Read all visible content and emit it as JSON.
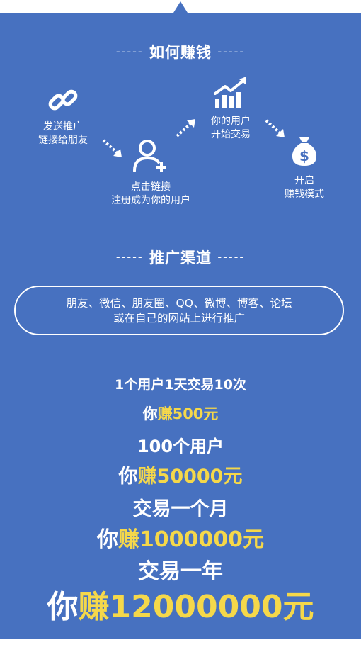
{
  "how_to_earn": {
    "title": "如何赚钱",
    "dash": "-----",
    "steps": [
      {
        "line1": "发送推广",
        "line2": "链接给朋友",
        "icon": "link-icon"
      },
      {
        "line1": "点击链接",
        "line2": "注册成为你的用户",
        "icon": "add-user-icon"
      },
      {
        "line1": "你的用户",
        "line2": "开始交易",
        "icon": "growth-chart-icon"
      },
      {
        "line1": "开启",
        "line2": "赚钱模式",
        "icon": "money-bag-icon"
      }
    ]
  },
  "channels": {
    "title": "推广渠道",
    "dash": "-----",
    "line1": "朋友、微信、朋友圈、QQ、微博、博客、论坛",
    "line2": "或在自己的网站上进行推广"
  },
  "earnings": {
    "l1": "1个用户1天交易10次",
    "l2_prefix": "你",
    "l2_hl": "赚",
    "l2_num": "500",
    "l2_unit": "元",
    "l3": "100个用户",
    "l4_prefix": "你",
    "l4_hl": "赚",
    "l4_num": "50000",
    "l4_unit": "元",
    "l5": "交易一个月",
    "l6_prefix": "你",
    "l6_hl": "赚",
    "l6_num": "1000000",
    "l6_unit": "元",
    "l7": "交易一年",
    "l8_prefix": "你",
    "l8_hl": "赚",
    "l8_num": "12000000",
    "l8_unit": "元"
  },
  "colors": {
    "background": "#4771c0",
    "highlight": "#f5d84a",
    "text": "#ffffff"
  }
}
